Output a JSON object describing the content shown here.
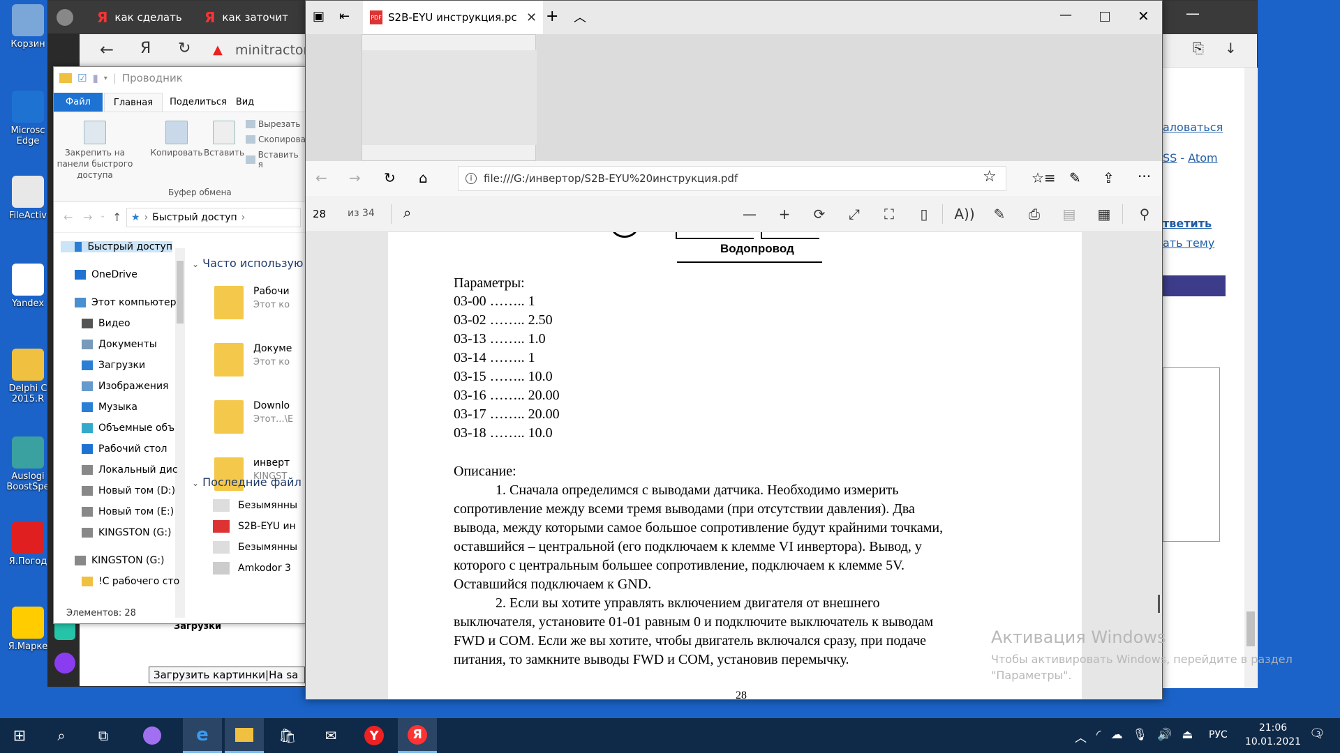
{
  "desktop": {
    "icons": [
      {
        "label": "Корзин",
        "color": "#7aa7d8",
        "glyph": "recycle-bin-icon"
      },
      {
        "label": "Microsc Edge",
        "color": "#1e73d2",
        "glyph": "edge-icon"
      },
      {
        "label": "FileActiv",
        "color": "#e8e8e8",
        "glyph": "xml-file-icon"
      },
      {
        "label": "Yandex",
        "color": "#ffffff",
        "glyph": "yandex-icon"
      },
      {
        "label": "Delphi C 2015.R",
        "color": "#f0c040",
        "glyph": "folder-icon"
      },
      {
        "label": "Auslogi BoostSpe",
        "color": "#3aa0a0",
        "glyph": "boostspeed-icon"
      },
      {
        "label": "Я.Погод",
        "color": "#e02020",
        "glyph": "umbrella-icon"
      },
      {
        "label": "Я.Марке",
        "color": "#ffcc00",
        "glyph": "market-icon"
      }
    ]
  },
  "yandex_browser": {
    "tabs": [
      "как сделать",
      "как заточит"
    ],
    "address": "minitractor",
    "forum": {
      "counter": "0",
      "link1": "аловаться",
      "link2_a": "SS",
      "link2_sep": " - ",
      "link2_b": "Atom",
      "reply": "тветить",
      "topic": "ать тему",
      "upload_label": "Загрузки",
      "upload_button": "Загрузить картинки|На sa"
    }
  },
  "explorer": {
    "title": "Проводник",
    "tabs": [
      "Файл",
      "Главная",
      "Поделиться",
      "Вид"
    ],
    "ribbon": {
      "pin": "Закрепить на панели быстрого доступа",
      "copy": "Копировать",
      "paste": "Вставить",
      "cut": "Вырезать",
      "copy_path": "Скопирова",
      "paste_shortcut": "Вставить я",
      "group": "Буфер обмена"
    },
    "breadcrumb": "Быстрый доступ",
    "nav": [
      {
        "label": "Быстрый доступ",
        "icon": "star-icon",
        "color": "#2a7fd4",
        "indent": 0,
        "selected": true
      },
      {
        "label": "OneDrive",
        "icon": "cloud-icon",
        "color": "#1e73d2",
        "indent": 0
      },
      {
        "label": "Этот компьютер",
        "icon": "computer-icon",
        "color": "#4a8fd0",
        "indent": 0
      },
      {
        "label": "Видео",
        "icon": "video-icon",
        "color": "#555",
        "indent": 1
      },
      {
        "label": "Документы",
        "icon": "document-icon",
        "color": "#7799bb",
        "indent": 1
      },
      {
        "label": "Загрузки",
        "icon": "download-icon",
        "color": "#2a7fd4",
        "indent": 1
      },
      {
        "label": "Изображения",
        "icon": "pictures-icon",
        "color": "#6699cc",
        "indent": 1
      },
      {
        "label": "Музыка",
        "icon": "music-icon",
        "color": "#2a7fd4",
        "indent": 1
      },
      {
        "label": "Объемные объ",
        "icon": "3d-objects-icon",
        "color": "#33aacc",
        "indent": 1
      },
      {
        "label": "Рабочий стол",
        "icon": "desktop-icon",
        "color": "#1e73d2",
        "indent": 1
      },
      {
        "label": "Локальный дис",
        "icon": "drive-icon",
        "color": "#888",
        "indent": 1
      },
      {
        "label": "Новый том (D:)",
        "icon": "drive-icon",
        "color": "#888",
        "indent": 1
      },
      {
        "label": "Новый том (E:)",
        "icon": "drive-icon",
        "color": "#888",
        "indent": 1
      },
      {
        "label": "KINGSTON (G:)",
        "icon": "usb-drive-icon",
        "color": "#888",
        "indent": 1
      },
      {
        "label": "KINGSTON (G:)",
        "icon": "usb-drive-icon",
        "color": "#888",
        "indent": 0
      },
      {
        "label": "!С рабочего сто",
        "icon": "folder-icon",
        "color": "#f0c040",
        "indent": 1
      }
    ],
    "frequent_header": "Часто использую",
    "frequent": [
      {
        "name": "Рабочи",
        "sub": "Этот ко"
      },
      {
        "name": "Докуме",
        "sub": "Этот ко"
      },
      {
        "name": "Downlo",
        "sub": "Этот...\\E"
      },
      {
        "name": "инверт",
        "sub": "KINGST"
      }
    ],
    "recent_header": "Последние файл",
    "recent": [
      "Безымянны",
      "S2B-EYU ин",
      "Безымянны",
      "Amkodor 3"
    ],
    "status": "Элементов: 28"
  },
  "edge": {
    "tab_title": "S2B-EYU инструкция.pc",
    "url": "file:///G:/инвертор/S2B-EYU%20инструкция.pdf",
    "page_current": "28",
    "page_total": "из 34"
  },
  "pdf": {
    "diagram_label": "Водопровод",
    "params_title": "Параметры:",
    "params": [
      "03-00 …….. 1",
      "03-02 …….. 2.50",
      "03-13 …….. 1.0",
      "03-14 …….. 1",
      "03-15 …….. 10.0",
      "03-16 …….. 20.00",
      "03-17 …….. 20.00",
      "03-18 …….. 10.0"
    ],
    "desc_title": "Описание:",
    "desc_lines": [
      "1. Сначала определимся с выводами датчика. Необходимо измерить",
      "сопротивление между всеми тремя выводами (при отсутствии давления). Два",
      "вывода, между которыми самое большое сопротивление будут крайними точками,",
      "оставшийся – центральной (его подключаем к клемме VI инвертора). Вывод, у",
      "которого с центральным большее сопротивление, подключаем к клемме 5V.",
      "Оставшийся подключаем к GND.",
      "2. Если вы хотите управлять включением двигателя от внешнего",
      "выключателя, установите 01-01 равным  0  и подключите выключатель к выводам",
      "FWD и COM. Если же вы хотите, чтобы двигатель включался сразу, при подаче",
      "питания, то замкните выводы FWD и COM, установив перемычку."
    ],
    "page_number": "28"
  },
  "activation": {
    "title": "Активация Windows",
    "line1": "Чтобы активировать Windows, перейдите в раздел",
    "line2": "\"Параметры\"."
  },
  "taskbar": {
    "lang": "РУС",
    "time": "21:06",
    "date": "10.01.2021",
    "notifications": "3"
  }
}
